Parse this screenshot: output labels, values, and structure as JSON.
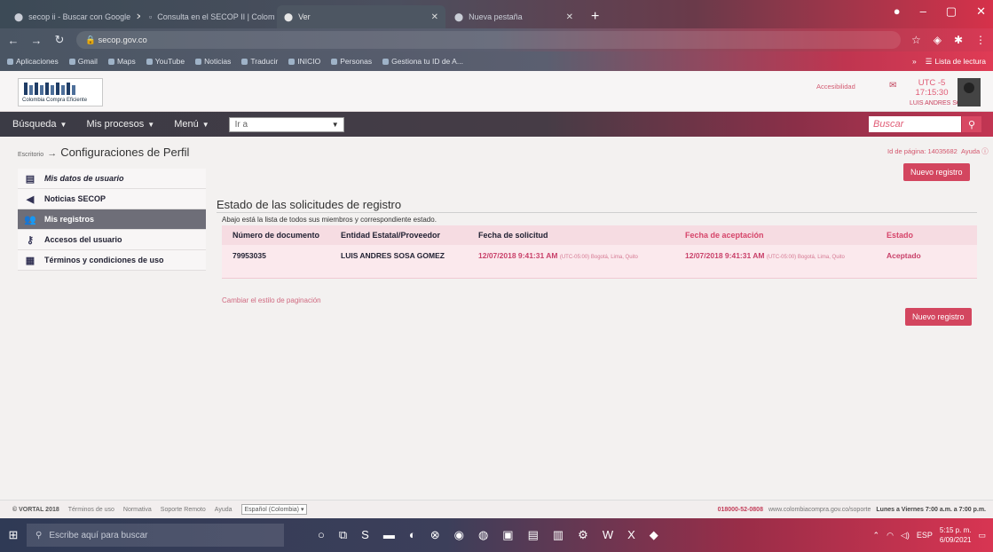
{
  "browser": {
    "tabs": [
      {
        "label": "secop ii - Buscar con Google",
        "active": false
      },
      {
        "label": "Consulta en el SECOP II | Colombia",
        "active": false
      },
      {
        "label": "Ver",
        "active": true
      },
      {
        "label": "Nueva pestaña",
        "active": false
      }
    ],
    "url": "secop.gov.co",
    "bookmarks": [
      "Aplicaciones",
      "Gmail",
      "Maps",
      "YouTube",
      "Noticias",
      "Traducir",
      "INICIO",
      "Personas",
      "Gestiona tu ID de A..."
    ],
    "reading_list": "Lista de lectura"
  },
  "header": {
    "logo_caption": "Colombia Compra Eficiente",
    "accessibility_link": "Accesibilidad",
    "utc": "UTC -5 17:15:30",
    "user_name": "LUIS ANDRES SOSA..."
  },
  "nav": {
    "items": [
      "Búsqueda",
      "Mis procesos",
      "Menú"
    ],
    "goto": "Ir a",
    "search_placeholder": "Buscar"
  },
  "breadcrumb": {
    "small": "Escritorio",
    "title": "Configuraciones de Perfil"
  },
  "page_meta": {
    "page_id": "Id de página: 14035682",
    "help": "Ayuda"
  },
  "sidebar": {
    "items": [
      {
        "label": "Mis datos de usuario",
        "icon": "user-card-icon",
        "active": false,
        "italic": true
      },
      {
        "label": "Noticias SECOP",
        "icon": "megaphone-icon",
        "active": false,
        "italic": false
      },
      {
        "label": "Mis registros",
        "icon": "people-icon",
        "active": true,
        "italic": false
      },
      {
        "label": "Accesos del usuario",
        "icon": "key-icon",
        "active": false,
        "italic": false
      },
      {
        "label": "Términos y condiciones de uso",
        "icon": "document-icon",
        "active": false,
        "italic": false
      }
    ]
  },
  "main": {
    "new_button": "Nuevo registro",
    "section_title": "Estado de las solicitudes de registro",
    "description": "Abajo está la lista de todos sus miembros y correspondiente estado.",
    "table": {
      "headers": [
        "Número de documento",
        "Entidad Estatal/Proveedor",
        "Fecha de solicitud",
        "Fecha de aceptación",
        "Estado"
      ],
      "rows": [
        {
          "doc": "79953035",
          "entity": "LUIS ANDRES SOSA GOMEZ",
          "request_date": "12/07/2018 9:41:31 AM",
          "request_tz": "(UTC-05:00) Bogotá, Lima, Quito",
          "accept_date": "12/07/2018 9:41:31 AM",
          "accept_tz": "(UTC-05:00) Bogotá, Lima, Quito",
          "status": "Aceptado"
        }
      ]
    },
    "paging_link": "Cambiar el estilo de paginación"
  },
  "footer": {
    "copyright": "© VORTAL 2018",
    "links": [
      "Términos de uso",
      "Normativa",
      "Soporte Remoto",
      "Ayuda"
    ],
    "language": "Español (Colombia)",
    "phone": "018000-52-0808",
    "support": "www.colombiacompra.gov.co/soporte",
    "hours": "Lunes a Viernes 7:00 a.m. a 7:00 p.m."
  },
  "taskbar": {
    "search_placeholder": "Escribe aquí para buscar",
    "time": "5:15 p. m.",
    "date": "6/09/2021",
    "lang": "ESP"
  }
}
